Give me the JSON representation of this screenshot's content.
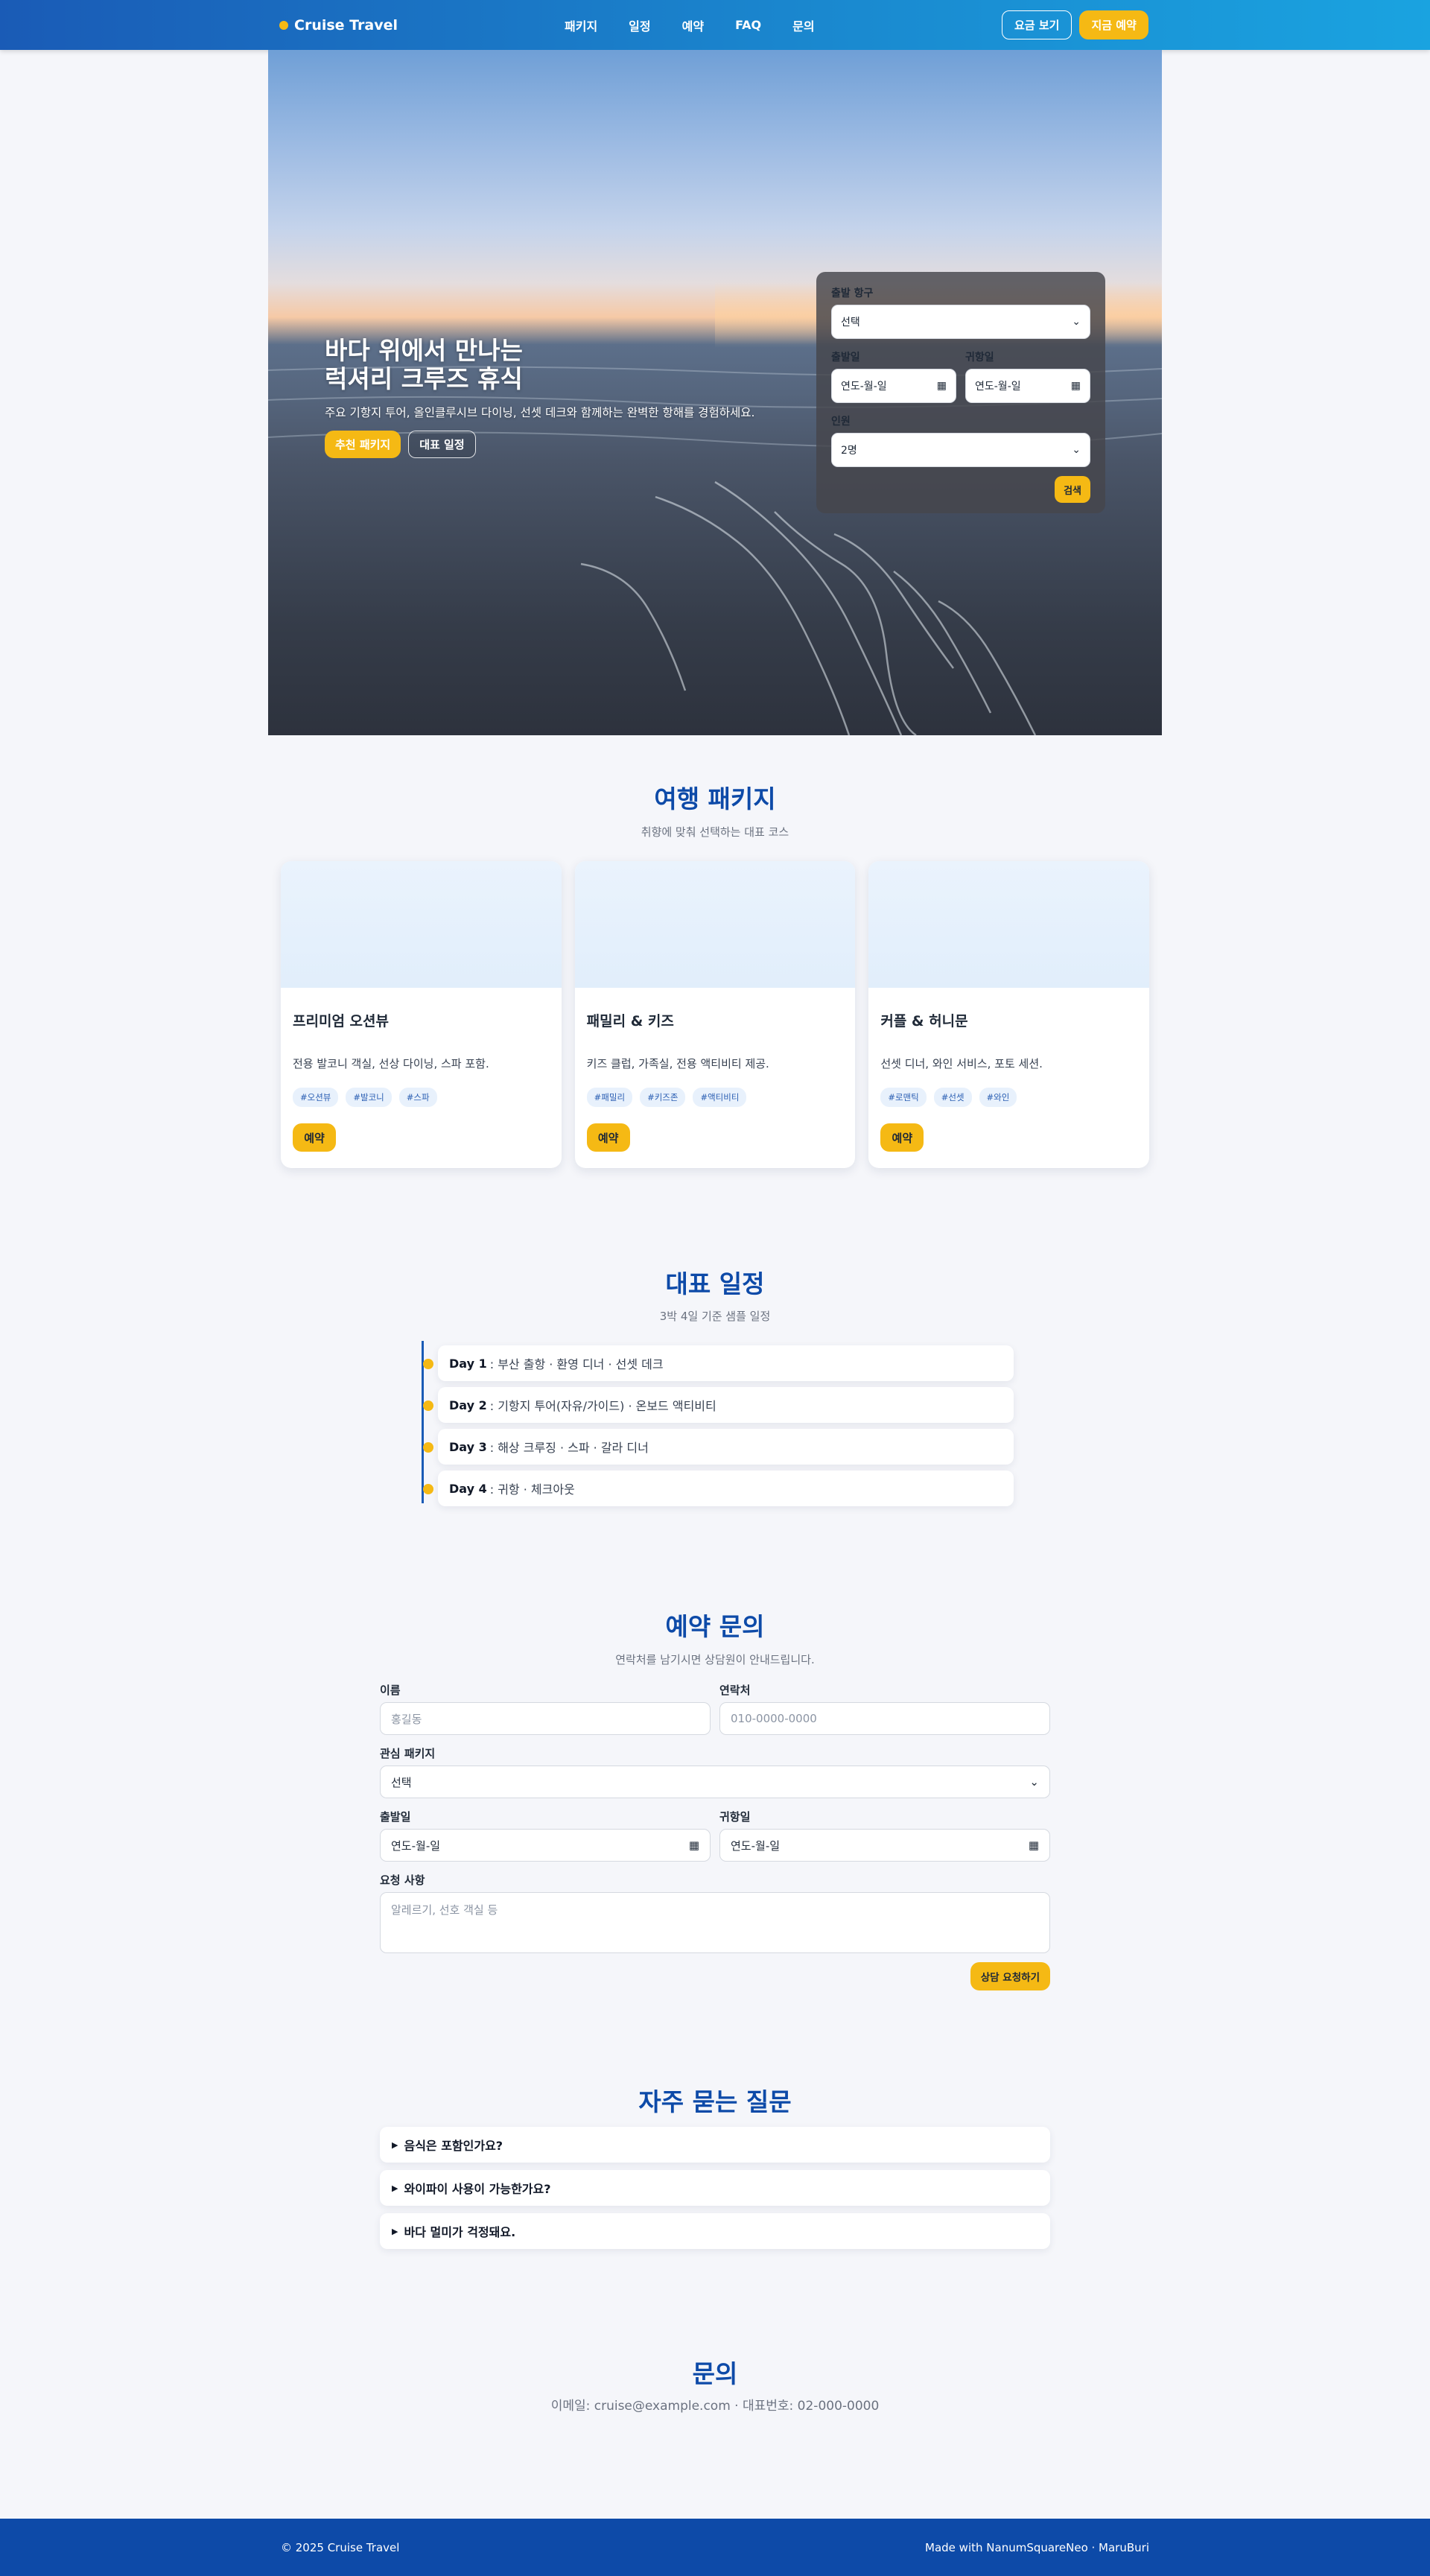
{
  "nav": {
    "brand": "Cruise Travel",
    "links": [
      "패키지",
      "일정",
      "예약",
      "FAQ",
      "문의"
    ],
    "price_button": "요금 보기",
    "book_button": "지금 예약"
  },
  "hero": {
    "title_line1": "바다 위에서 만나는",
    "title_line2": "럭셔리 크루즈 휴식",
    "subtitle": "주요 기항지 투어, 올인클루시브 다이닝, 선셋 데크와 함께하는 완벽한 항해를 경험하세요.",
    "primary_button": "추천 패키지",
    "secondary_button": "대표 일정",
    "search": {
      "port_label": "출발 항구",
      "port_value": "선택",
      "depart_label": "출발일",
      "depart_value": "연도-월-일",
      "return_label": "귀항일",
      "return_value": "연도-월-일",
      "people_label": "인원",
      "people_value": "2명",
      "submit": "검색"
    }
  },
  "packages": {
    "title": "여행 패키지",
    "subtitle": "취향에 맞춰 선택하는 대표 코스",
    "items": [
      {
        "name": "프리미엄 오션뷰",
        "desc": "전용 발코니 객실, 선상 다이닝, 스파 포함.",
        "tags": [
          "#오션뷰",
          "#발코니",
          "#스파"
        ],
        "button": "예약"
      },
      {
        "name": "패밀리 & 키즈",
        "desc": "키즈 클럽, 가족실, 전용 액티비티 제공.",
        "tags": [
          "#패밀리",
          "#키즈존",
          "#액티비티"
        ],
        "button": "예약"
      },
      {
        "name": "커플 & 허니문",
        "desc": "선셋 디너, 와인 서비스, 포토 세션.",
        "tags": [
          "#로맨틱",
          "#선셋",
          "#와인"
        ],
        "button": "예약"
      }
    ]
  },
  "itinerary": {
    "title": "대표 일정",
    "subtitle": "3박 4일 기준 샘플 일정",
    "days": [
      {
        "day": "Day 1",
        "text": ": 부산 출항 · 환영 디너 · 선셋 데크"
      },
      {
        "day": "Day 2",
        "text": ": 기항지 투어(자유/가이드) · 온보드 액티비티"
      },
      {
        "day": "Day 3",
        "text": ": 해상 크루징 · 스파 · 갈라 디너"
      },
      {
        "day": "Day 4",
        "text": ": 귀항 · 체크아웃"
      }
    ]
  },
  "inquiry": {
    "title": "예약 문의",
    "subtitle": "연락처를 남기시면 상담원이 안내드립니다.",
    "name_label": "이름",
    "name_placeholder": "홍길동",
    "phone_label": "연락처",
    "phone_placeholder": "010-0000-0000",
    "package_label": "관심 패키지",
    "package_value": "선택",
    "depart_label": "출발일",
    "depart_value": "연도-월-일",
    "return_label": "귀항일",
    "return_value": "연도-월-일",
    "request_label": "요청 사항",
    "request_placeholder": "알레르기, 선호 객실 등",
    "submit": "상담 요청하기"
  },
  "faq": {
    "title": "자주 묻는 질문",
    "items": [
      "음식은 포함인가요?",
      "와이파이 사용이 가능한가요?",
      "바다 멀미가 걱정돼요."
    ]
  },
  "contact": {
    "title": "문의",
    "line": "이메일: cruise@example.com · 대표번호: 02-000-0000"
  },
  "footer": {
    "left": "© 2025 Cruise Travel",
    "right": "Made with NanumSquareNeo · MaruBuri"
  },
  "colors": {
    "primary": "#0d4aa8",
    "accent": "#f5b914",
    "background": "#f5f6fa"
  }
}
